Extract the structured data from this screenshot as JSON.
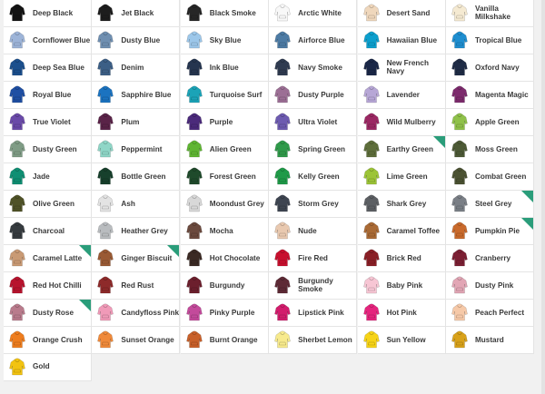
{
  "swatches": [
    {
      "label": "Deep Black",
      "color": "#141414",
      "flag": false
    },
    {
      "label": "Jet Black",
      "color": "#1d1d1d",
      "flag": false
    },
    {
      "label": "Black Smoke",
      "color": "#262626",
      "flag": false
    },
    {
      "label": "Arctic White",
      "color": "#f8f8f8",
      "flag": false
    },
    {
      "label": "Desert Sand",
      "color": "#efd7bc",
      "flag": false
    },
    {
      "label": "Vanilla Milkshake",
      "color": "#f5ead2",
      "flag": false
    },
    {
      "label": "Cornflower Blue",
      "color": "#9db4d8",
      "flag": false
    },
    {
      "label": "Dusty Blue",
      "color": "#6f8fb1",
      "flag": false
    },
    {
      "label": "Sky Blue",
      "color": "#9cc7ea",
      "flag": false
    },
    {
      "label": "Airforce Blue",
      "color": "#4d7ba4",
      "flag": false
    },
    {
      "label": "Hawaiian Blue",
      "color": "#0c9fcd",
      "flag": false
    },
    {
      "label": "Tropical Blue",
      "color": "#1e8ed0",
      "flag": false
    },
    {
      "label": "Deep Sea Blue",
      "color": "#1b4f8d",
      "flag": false
    },
    {
      "label": "Denim",
      "color": "#3c5f86",
      "flag": false
    },
    {
      "label": "Ink Blue",
      "color": "#25354f",
      "flag": false
    },
    {
      "label": "Navy Smoke",
      "color": "#2f3b50",
      "flag": false
    },
    {
      "label": "New French Navy",
      "color": "#1a2747",
      "flag": false
    },
    {
      "label": "Oxford Navy",
      "color": "#1f2c46",
      "flag": false
    },
    {
      "label": "Royal Blue",
      "color": "#1f4fa3",
      "flag": false
    },
    {
      "label": "Sapphire Blue",
      "color": "#1b73c0",
      "flag": false
    },
    {
      "label": "Turquoise Surf",
      "color": "#1ba3b7",
      "flag": false
    },
    {
      "label": "Dusty Purple",
      "color": "#9c6f95",
      "flag": false
    },
    {
      "label": "Lavender",
      "color": "#b7a7d6",
      "flag": false
    },
    {
      "label": "Magenta Magic",
      "color": "#7d2b6d",
      "flag": false
    },
    {
      "label": "True Violet",
      "color": "#6a4aa8",
      "flag": false
    },
    {
      "label": "Plum",
      "color": "#5a2348",
      "flag": false
    },
    {
      "label": "Purple",
      "color": "#4b2a7b",
      "flag": false
    },
    {
      "label": "Ultra Violet",
      "color": "#6d5bb0",
      "flag": false
    },
    {
      "label": "Wild Mulberry",
      "color": "#9b2863",
      "flag": false
    },
    {
      "label": "Apple Green",
      "color": "#8fc14a",
      "flag": false
    },
    {
      "label": "Dusty Green",
      "color": "#7f9c85",
      "flag": false
    },
    {
      "label": "Peppermint",
      "color": "#8fd6c7",
      "flag": false
    },
    {
      "label": "Alien Green",
      "color": "#5fb533",
      "flag": false
    },
    {
      "label": "Spring Green",
      "color": "#2f9a4a",
      "flag": false
    },
    {
      "label": "Earthy Green",
      "color": "#5e6e3b",
      "flag": true
    },
    {
      "label": "Moss Green",
      "color": "#4d5a36",
      "flag": false
    },
    {
      "label": "Jade",
      "color": "#0f8f73",
      "flag": false
    },
    {
      "label": "Bottle Green",
      "color": "#17402c",
      "flag": false
    },
    {
      "label": "Forest Green",
      "color": "#1f4a2b",
      "flag": false
    },
    {
      "label": "Kelly Green",
      "color": "#1f9a48",
      "flag": false
    },
    {
      "label": "Lime Green",
      "color": "#9cc437",
      "flag": false
    },
    {
      "label": "Combat Green",
      "color": "#4b5232",
      "flag": false
    },
    {
      "label": "Olive Green",
      "color": "#4f5227",
      "flag": false
    },
    {
      "label": "Ash",
      "color": "#e3e3e3",
      "flag": false
    },
    {
      "label": "Moondust Grey",
      "color": "#d8d8d8",
      "flag": false
    },
    {
      "label": "Storm Grey",
      "color": "#3e4551",
      "flag": false
    },
    {
      "label": "Shark Grey",
      "color": "#5c5f63",
      "flag": false
    },
    {
      "label": "Steel Grey",
      "color": "#7a7f86",
      "flag": true
    },
    {
      "label": "Charcoal",
      "color": "#363b3f",
      "flag": false
    },
    {
      "label": "Heather Grey",
      "color": "#b9bcbf",
      "flag": false
    },
    {
      "label": "Mocha",
      "color": "#6b4a3e",
      "flag": false
    },
    {
      "label": "Nude",
      "color": "#e9c9b0",
      "flag": false
    },
    {
      "label": "Caramel Toffee",
      "color": "#a96a35",
      "flag": false
    },
    {
      "label": "Pumpkin Pie",
      "color": "#c96a2c",
      "flag": true
    },
    {
      "label": "Caramel Latte",
      "color": "#c99a74",
      "flag": true
    },
    {
      "label": "Ginger Biscuit",
      "color": "#9a5a34",
      "flag": true
    },
    {
      "label": "Hot Chocolate",
      "color": "#3b2a24",
      "flag": false
    },
    {
      "label": "Fire Red",
      "color": "#c8102e",
      "flag": false
    },
    {
      "label": "Brick Red",
      "color": "#8a1f26",
      "flag": false
    },
    {
      "label": "Cranberry",
      "color": "#7c1f33",
      "flag": false
    },
    {
      "label": "Red Hot Chilli",
      "color": "#b8142e",
      "flag": false
    },
    {
      "label": "Red Rust",
      "color": "#8e2a2a",
      "flag": false
    },
    {
      "label": "Burgundy",
      "color": "#6c1f2d",
      "flag": false
    },
    {
      "label": "Burgundy Smoke",
      "color": "#5e2a35",
      "flag": false
    },
    {
      "label": "Baby Pink",
      "color": "#f7c6d4",
      "flag": false
    },
    {
      "label": "Dusty Pink",
      "color": "#e2a6b5",
      "flag": false
    },
    {
      "label": "Dusty Rose",
      "color": "#b97b8c",
      "flag": true
    },
    {
      "label": "Candyfloss Pink",
      "color": "#f09ab8",
      "flag": false
    },
    {
      "label": "Pinky Purple",
      "color": "#c34a9b",
      "flag": false
    },
    {
      "label": "Lipstick Pink",
      "color": "#d21c6c",
      "flag": false
    },
    {
      "label": "Hot Pink",
      "color": "#e5247d",
      "flag": false
    },
    {
      "label": "Peach Perfect",
      "color": "#f6c9a8",
      "flag": false
    },
    {
      "label": "Orange Crush",
      "color": "#ee7d1e",
      "flag": false
    },
    {
      "label": "Sunset Orange",
      "color": "#f08a3a",
      "flag": false
    },
    {
      "label": "Burnt Orange",
      "color": "#c8602a",
      "flag": false
    },
    {
      "label": "Sherbet Lemon",
      "color": "#f7ea8d",
      "flag": false
    },
    {
      "label": "Sun Yellow",
      "color": "#f7d417",
      "flag": false
    },
    {
      "label": "Mustard",
      "color": "#d9a21a",
      "flag": false
    },
    {
      "label": "Gold",
      "color": "#f2c311",
      "flag": false
    }
  ]
}
